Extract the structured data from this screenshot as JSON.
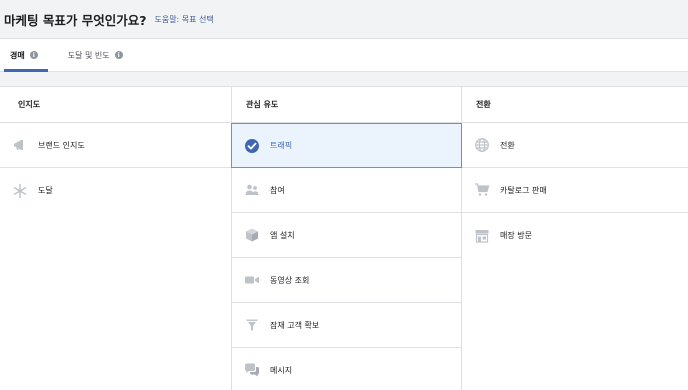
{
  "header": {
    "title": "마케팅 목표가 무엇인가요?",
    "help_link": "도움말: 목표 선택"
  },
  "tabs": [
    {
      "label": "경매",
      "active": true
    },
    {
      "label": "도달 및 빈도",
      "active": false
    }
  ],
  "columns": [
    {
      "header": "인지도",
      "options": [
        {
          "label": "브랜드 인지도",
          "icon": "megaphone-icon"
        },
        {
          "label": "도달",
          "icon": "snowflake-icon"
        }
      ]
    },
    {
      "header": "관심 유도",
      "options": [
        {
          "label": "트래픽",
          "icon": "check-circle-icon",
          "selected": true
        },
        {
          "label": "참여",
          "icon": "people-icon"
        },
        {
          "label": "앱 설치",
          "icon": "cube-icon"
        },
        {
          "label": "동영상 조회",
          "icon": "video-camera-icon"
        },
        {
          "label": "잠재 고객 확보",
          "icon": "funnel-icon"
        },
        {
          "label": "메시지",
          "icon": "chat-bubbles-icon"
        }
      ]
    },
    {
      "header": "전환",
      "options": [
        {
          "label": "전환",
          "icon": "globe-icon"
        },
        {
          "label": "카탈로그 판매",
          "icon": "shopping-cart-icon"
        },
        {
          "label": "매장 방문",
          "icon": "store-icon"
        }
      ]
    }
  ],
  "colors": {
    "accent": "#4267b2",
    "selected_bg": "#ebf3fd",
    "selected_border": "#5890ff",
    "icon_gray": "#bec3c9",
    "page_bg": "#f2f3f5"
  }
}
